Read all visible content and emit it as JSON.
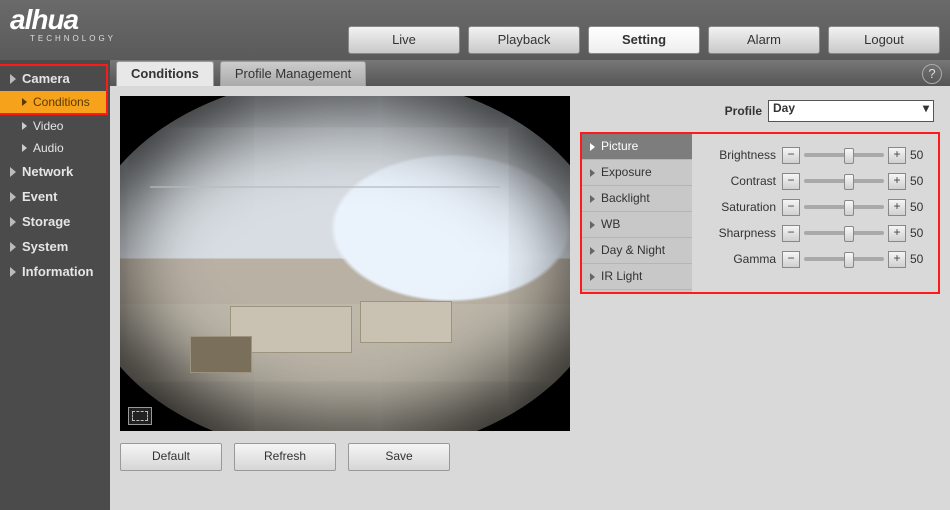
{
  "brand": {
    "name": "alhua",
    "sub": "TECHNOLOGY"
  },
  "topnav": {
    "live": "Live",
    "playback": "Playback",
    "setting": "Setting",
    "alarm": "Alarm",
    "logout": "Logout"
  },
  "sidebar": {
    "camera": "Camera",
    "camera_items": {
      "conditions": "Conditions",
      "video": "Video",
      "audio": "Audio"
    },
    "network": "Network",
    "event": "Event",
    "storage": "Storage",
    "system": "System",
    "information": "Information"
  },
  "tabs": {
    "conditions": "Conditions",
    "profile_mgmt": "Profile Management"
  },
  "profile": {
    "label": "Profile",
    "selected": "Day"
  },
  "subtabs": {
    "picture": "Picture",
    "exposure": "Exposure",
    "backlight": "Backlight",
    "wb": "WB",
    "daynight": "Day & Night",
    "irlight": "IR Light"
  },
  "sliders": {
    "brightness": {
      "label": "Brightness",
      "value": 50
    },
    "contrast": {
      "label": "Contrast",
      "value": 50
    },
    "saturation": {
      "label": "Saturation",
      "value": 50
    },
    "sharpness": {
      "label": "Sharpness",
      "value": 50
    },
    "gamma": {
      "label": "Gamma",
      "value": 50
    }
  },
  "buttons": {
    "default": "Default",
    "refresh": "Refresh",
    "save": "Save"
  },
  "help": "?"
}
